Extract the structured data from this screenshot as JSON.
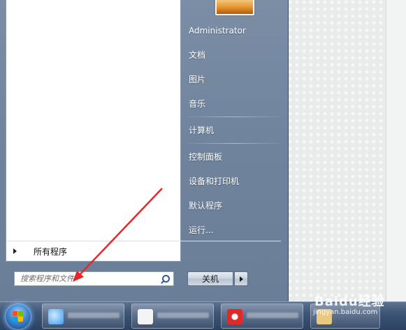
{
  "start_menu": {
    "all_programs_label": "所有程序",
    "search_placeholder": "搜索程序和文件",
    "user_name": "Administrator",
    "right_items": [
      {
        "label": "文档"
      },
      {
        "label": "图片"
      },
      {
        "label": "音乐"
      },
      {
        "label": "计算机"
      },
      {
        "label": "控制面板"
      },
      {
        "label": "设备和打印机"
      },
      {
        "label": "默认程序"
      },
      {
        "label": "运行..."
      }
    ],
    "shutdown_label": "关机"
  },
  "watermark": {
    "brand": "Baidu经验",
    "url": "jingyan.baidu.com"
  },
  "icons": [
    "search-icon",
    "windows-logo-icon",
    "chevron-right-icon",
    "arrow-annotation"
  ],
  "colors": {
    "annotation_arrow": "#e8262a",
    "menu_right_pane": "#6f839c"
  }
}
